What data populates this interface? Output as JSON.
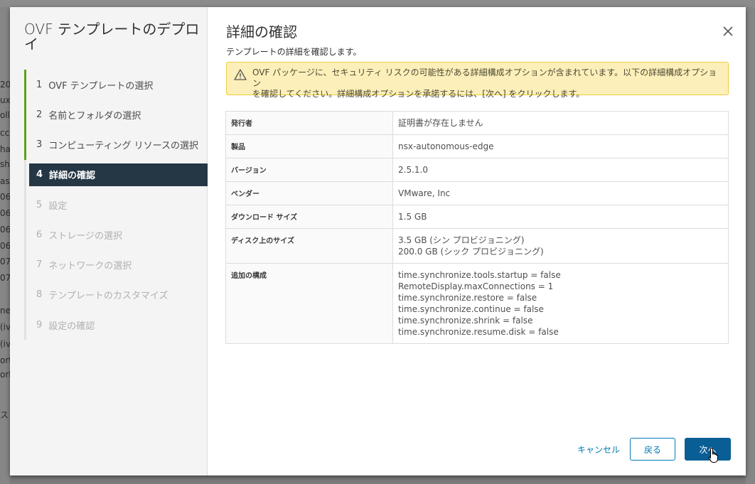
{
  "background": {
    "fragments": [
      "20",
      "ux",
      "olle",
      "cc",
      "hac",
      "sh",
      "as",
      "06",
      "06",
      "06",
      "06",
      "07",
      "07",
      "nec",
      "(iv",
      "(iv",
      "ort",
      "ork",
      "ス"
    ]
  },
  "wizard": {
    "title": "OVF テンプレートのデプロイ",
    "steps": [
      {
        "num": "1",
        "label": "OVF テンプレートの選択",
        "state": "done"
      },
      {
        "num": "2",
        "label": "名前とフォルダの選択",
        "state": "done"
      },
      {
        "num": "3",
        "label": "コンピューティング リソースの選択",
        "state": "done"
      },
      {
        "num": "4",
        "label": "詳細の確認",
        "state": "active"
      },
      {
        "num": "5",
        "label": "設定",
        "state": "future"
      },
      {
        "num": "6",
        "label": "ストレージの選択",
        "state": "future"
      },
      {
        "num": "7",
        "label": "ネットワークの選択",
        "state": "future"
      },
      {
        "num": "8",
        "label": "テンプレートのカスタマイズ",
        "state": "future"
      },
      {
        "num": "9",
        "label": "設定の確認",
        "state": "future"
      }
    ]
  },
  "main": {
    "title": "詳細の確認",
    "subtitle": "テンプレートの詳細を確認します。",
    "alert": {
      "icon": "warning-icon",
      "text_line1": "OVF パッケージに、セキュリティ リスクの可能性がある詳細構成オプションが含まれています。以下の詳細構成オプション",
      "text_line2": "を確認してください。詳細構成オプションを承諾するには、[次へ] をクリックします。"
    },
    "details": [
      {
        "key": "発行者",
        "values": [
          "証明書が存在しません"
        ]
      },
      {
        "key": "製品",
        "values": [
          "nsx-autonomous-edge"
        ]
      },
      {
        "key": "バージョン",
        "values": [
          "2.5.1.0"
        ]
      },
      {
        "key": "ベンダー",
        "values": [
          "VMware, Inc"
        ]
      },
      {
        "key": "ダウンロード サイズ",
        "values": [
          "1.5 GB"
        ]
      },
      {
        "key": "ディスク上のサイズ",
        "values": [
          "3.5 GB (シン プロビジョニング)",
          "200.0 GB (シック プロビジョニング)"
        ]
      },
      {
        "key": "追加の構成",
        "values": [
          "time.synchronize.tools.startup = false",
          "RemoteDisplay.maxConnections = 1",
          "time.synchronize.restore = false",
          "time.synchronize.continue = false",
          "time.synchronize.shrink = false",
          "time.synchronize.resume.disk = false"
        ]
      }
    ]
  },
  "footer": {
    "cancel_label": "キャンセル",
    "back_label": "戻る",
    "next_label": "次へ"
  },
  "colors": {
    "accent": "#0079b8",
    "primary_button": "#0a5e96",
    "active_step": "#253645",
    "done_step": "#5aa220",
    "alert_bg": "#fcefb9"
  }
}
